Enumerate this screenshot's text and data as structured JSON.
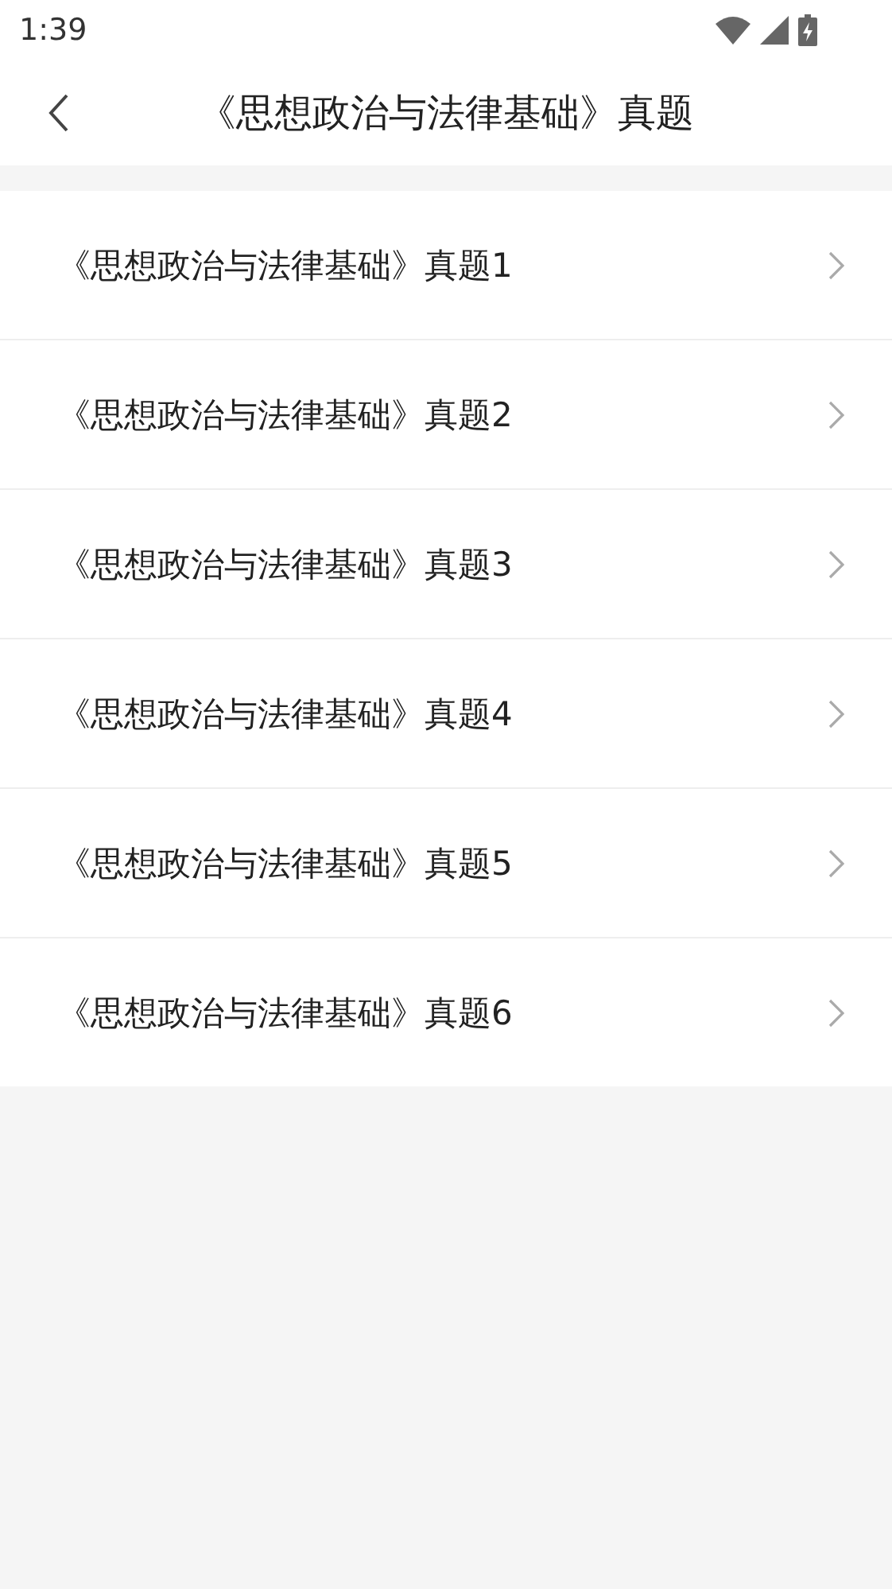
{
  "status_bar": {
    "time": "1:39"
  },
  "header": {
    "title": "《思想政治与法律基础》真题"
  },
  "items": [
    {
      "label": "《思想政治与法律基础》真题1"
    },
    {
      "label": "《思想政治与法律基础》真题2"
    },
    {
      "label": "《思想政治与法律基础》真题3"
    },
    {
      "label": "《思想政治与法律基础》真题4"
    },
    {
      "label": "《思想政治与法律基础》真题5"
    },
    {
      "label": "《思想政治与法律基础》真题6"
    }
  ]
}
